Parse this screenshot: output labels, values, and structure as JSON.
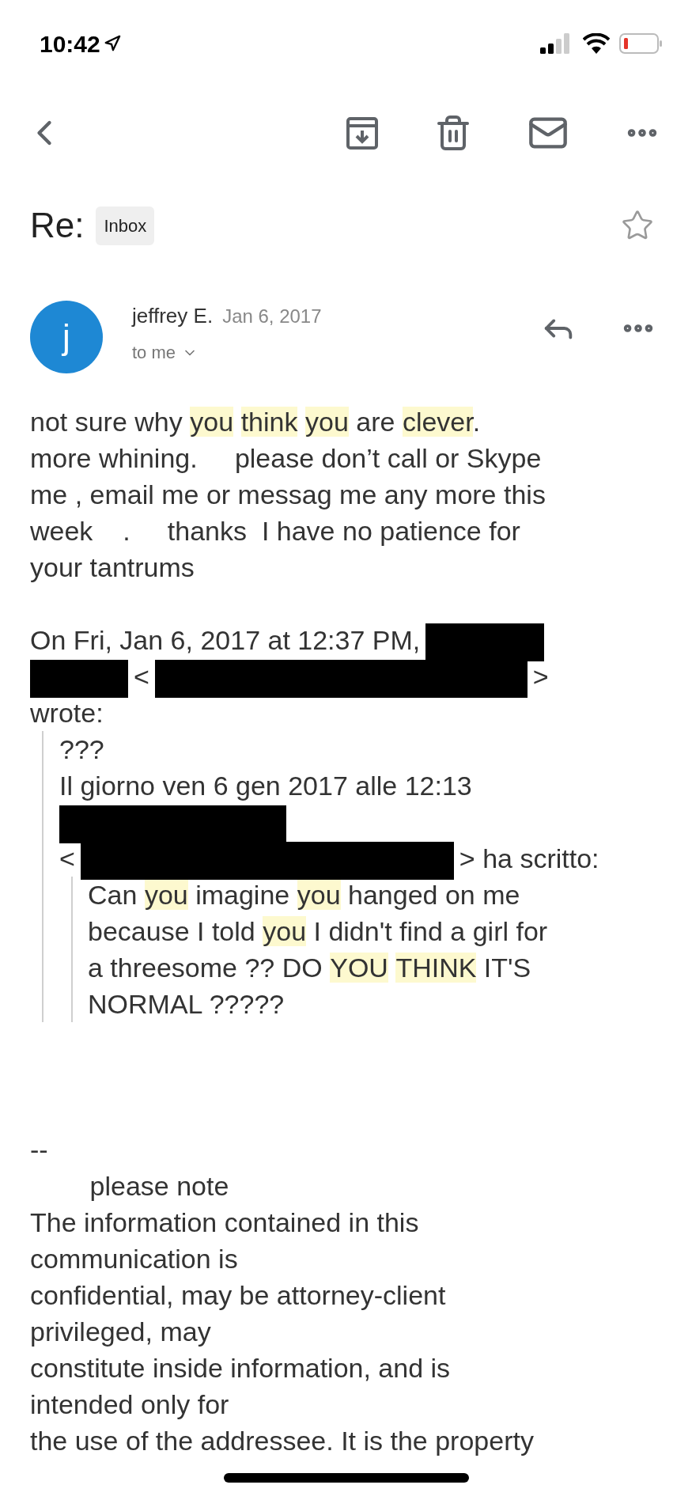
{
  "status_bar": {
    "time": "10:42"
  },
  "subject": {
    "title": "Re:",
    "label": "Inbox",
    "starred": false
  },
  "message": {
    "avatar_letter": "j",
    "sender": "jeffrey E.",
    "date": "Jan 6, 2017",
    "recipient": "to me"
  },
  "body": [
    {
      "kind": "paragraph",
      "lines": [
        [
          {
            "kind": "text",
            "text": "not sure why",
            "highlighted": false
          },
          {
            "kind": "text",
            "text": "you",
            "highlighted": true
          },
          {
            "kind": "text",
            "text": "think",
            "highlighted": true
          },
          {
            "kind": "text",
            "text": "you",
            "highlighted": true
          },
          {
            "kind": "text",
            "text": " are",
            "highlighted": false
          },
          {
            "kind": "text",
            "text": "clever",
            "highlighted": true
          },
          {
            "kind": "text",
            "text": ".",
            "highlighted": false
          }
        ],
        [
          {
            "kind": "text",
            "text": "more whining.     please don’t call or Skype",
            "highlighted": false
          }
        ],
        [
          {
            "kind": "text",
            "text": "me , email me or messag me any more this",
            "highlighted": false
          }
        ],
        [
          {
            "kind": "text",
            "text": "week    .     thanks  I have no patience for",
            "highlighted": false
          }
        ],
        [
          {
            "kind": "text",
            "text": "your tantrums",
            "highlighted": false
          }
        ]
      ]
    },
    {
      "kind": "paragraph",
      "lines": [
        [
          {
            "kind": "text",
            "text": "On Fri, Jan 6, 2017 at 12:37 PM,",
            "highlighted": false
          },
          {
            "kind": "redaction"
          }
        ],
        [
          {
            "kind": "redaction"
          },
          {
            "kind": "text",
            "text": "<",
            "highlighted": false
          },
          {
            "kind": "redaction"
          },
          {
            "kind": "text",
            "text": ">",
            "highlighted": false
          }
        ],
        [
          {
            "kind": "text",
            "text": "wrote:",
            "highlighted": false
          }
        ]
      ]
    },
    {
      "kind": "quote",
      "children": [
        {
          "kind": "paragraph",
          "lines": [
            [
              {
                "kind": "text",
                "text": "???",
                "highlighted": false
              }
            ],
            [
              {
                "kind": "text",
                "text": "Il giorno ven 6 gen 2017 alle 12:13",
                "highlighted": false
              }
            ],
            [
              {
                "kind": "redaction"
              }
            ],
            [
              {
                "kind": "text",
                "text": "<",
                "highlighted": false
              },
              {
                "kind": "redaction"
              },
              {
                "kind": "text",
                "text": "> ha scritto:",
                "highlighted": false
              }
            ]
          ]
        },
        {
          "kind": "quote",
          "children": [
            {
              "kind": "paragraph",
              "lines": [
                [
                  {
                    "kind": "text",
                    "text": "Can",
                    "highlighted": false
                  },
                  {
                    "kind": "text",
                    "text": "you",
                    "highlighted": true
                  },
                  {
                    "kind": "text",
                    "text": " imagine",
                    "highlighted": false
                  },
                  {
                    "kind": "text",
                    "text": "you",
                    "highlighted": true
                  },
                  {
                    "kind": "text",
                    "text": " hanged on me",
                    "highlighted": false
                  }
                ],
                [
                  {
                    "kind": "text",
                    "text": "because I told",
                    "highlighted": false
                  },
                  {
                    "kind": "text",
                    "text": "you",
                    "highlighted": true
                  },
                  {
                    "kind": "text",
                    "text": " I didn't find a girl for",
                    "highlighted": false
                  }
                ],
                [
                  {
                    "kind": "text",
                    "text": "a threesome ?? DO",
                    "highlighted": false
                  },
                  {
                    "kind": "text",
                    "text": "YOU",
                    "highlighted": true
                  },
                  {
                    "kind": "text",
                    "text": "THINK",
                    "highlighted": true
                  },
                  {
                    "kind": "text",
                    "text": " IT'S",
                    "highlighted": false
                  }
                ],
                [
                  {
                    "kind": "text",
                    "text": "NORMAL ?????",
                    "highlighted": false
                  }
                ]
              ]
            }
          ]
        }
      ]
    },
    {
      "kind": "signature",
      "lines": [
        [
          {
            "kind": "text",
            "text": "--",
            "highlighted": false
          }
        ],
        [
          {
            "kind": "text",
            "text": "        please note",
            "highlighted": false
          }
        ],
        [
          {
            "kind": "text",
            "text": "The information contained in this",
            "highlighted": false
          }
        ],
        [
          {
            "kind": "text",
            "text": "communication is",
            "highlighted": false
          }
        ],
        [
          {
            "kind": "text",
            "text": "confidential, may be attorney-client",
            "highlighted": false
          }
        ],
        [
          {
            "kind": "text",
            "text": "privileged, may",
            "highlighted": false
          }
        ],
        [
          {
            "kind": "text",
            "text": "constitute inside information, and is",
            "highlighted": false
          }
        ],
        [
          {
            "kind": "text",
            "text": "intended only for",
            "highlighted": false
          }
        ],
        [
          {
            "kind": "text",
            "text": "the use of the addressee. It is the property",
            "highlighted": false
          }
        ]
      ]
    }
  ]
}
